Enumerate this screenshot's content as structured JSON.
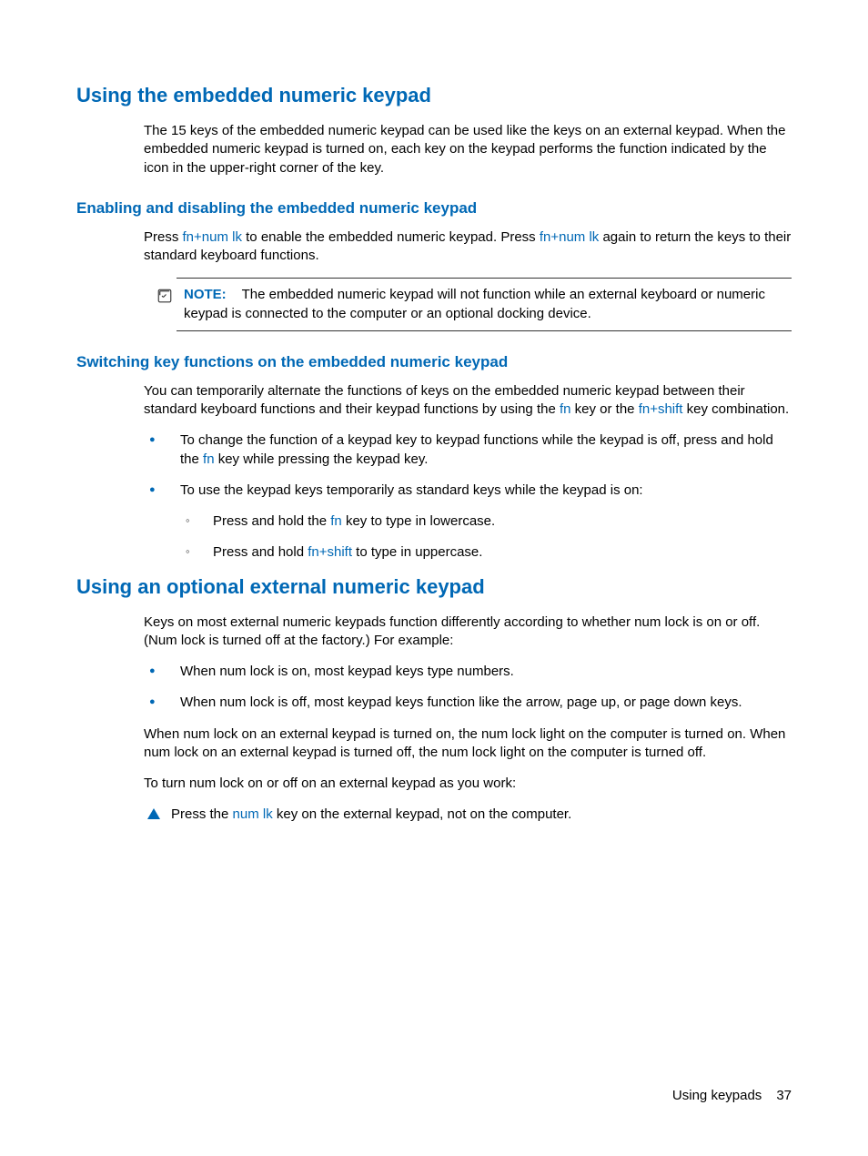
{
  "section1": {
    "heading": "Using the embedded numeric keypad",
    "intro": "The 15 keys of the embedded numeric keypad can be used like the keys on an external keypad. When the embedded numeric keypad is turned on, each key on the keypad performs the function indicated by the icon in the upper-right corner of the key.",
    "sub1": {
      "heading": "Enabling and disabling the embedded numeric keypad",
      "text_pre": "Press ",
      "kw1": "fn+num lk",
      "text_mid": " to enable the embedded numeric keypad. Press ",
      "kw2": "fn+num lk",
      "text_post": " again to return the keys to their standard keyboard functions.",
      "note_label": "NOTE:",
      "note_text": "The embedded numeric keypad will not function while an external keyboard or numeric keypad is connected to the computer or an optional docking device."
    },
    "sub2": {
      "heading": "Switching key functions on the embedded numeric keypad",
      "intro_p1": "You can temporarily alternate the functions of keys on the embedded numeric keypad between their standard keyboard functions and their keypad functions by using the ",
      "kw_fn": "fn",
      "intro_p2": " key or the ",
      "kw_fns": "fn+shift",
      "intro_p3": " key combination.",
      "b1_a": "To change the function of a keypad key to keypad functions while the keypad is off, press and hold the ",
      "b1_kw": "fn",
      "b1_b": " key while pressing the keypad key.",
      "b2": "To use the keypad keys temporarily as standard keys while the keypad is on:",
      "s1_a": "Press and hold the ",
      "s1_kw": "fn",
      "s1_b": " key to type in lowercase.",
      "s2_a": "Press and hold ",
      "s2_kw": "fn+shift",
      "s2_b": " to type in uppercase."
    }
  },
  "section2": {
    "heading": "Using an optional external numeric keypad",
    "intro": "Keys on most external numeric keypads function differently according to whether num lock is on or off. (Num lock is turned off at the factory.) For example:",
    "b1": "When num lock is on, most keypad keys type numbers.",
    "b2": "When num lock is off, most keypad keys function like the arrow, page up, or page down keys.",
    "p2": "When num lock on an external keypad is turned on, the num lock light on the computer is turned on. When num lock on an external keypad is turned off, the num lock light on the computer is turned off.",
    "p3": "To turn num lock on or off on an external keypad as you work:",
    "tri_a": "Press the ",
    "tri_kw": "num lk",
    "tri_b": " key on the external keypad, not on the computer."
  },
  "footer": {
    "section": "Using keypads",
    "page": "37"
  }
}
